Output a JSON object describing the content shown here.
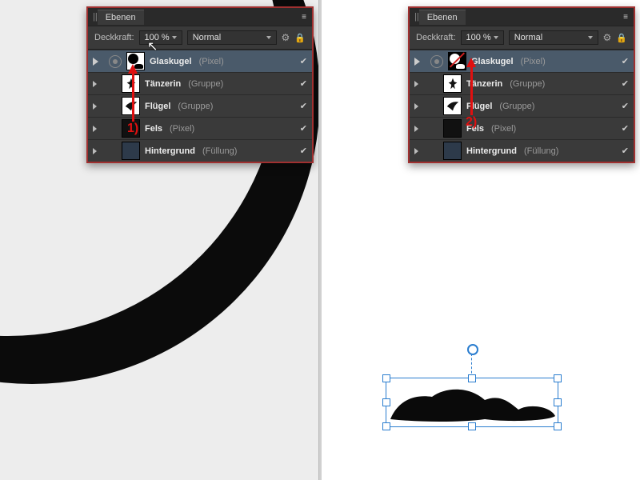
{
  "panel": {
    "title_tab": "Ebenen",
    "opacity_label": "Deckkraft:",
    "opacity_value": "100 %",
    "blend_mode": "Normal"
  },
  "layers": [
    {
      "name": "Glaskugel",
      "type": "(Pixel)",
      "selected": true,
      "thumb": "mask",
      "showPlay": true,
      "showVis": true
    },
    {
      "name": "Tänzerin",
      "type": "(Gruppe)",
      "selected": false,
      "thumb": "dancer",
      "showPlay": false,
      "showVis": false
    },
    {
      "name": "Flügel",
      "type": "(Gruppe)",
      "selected": false,
      "thumb": "wing",
      "showPlay": false,
      "showVis": false
    },
    {
      "name": "Fels",
      "type": "(Pixel)",
      "selected": false,
      "thumb": "empty",
      "showPlay": false,
      "showVis": false
    },
    {
      "name": "Hintergrund",
      "type": "(Füllung)",
      "selected": false,
      "thumb": "bg",
      "showPlay": false,
      "showVis": false
    }
  ],
  "annotations": {
    "left_label": "1)",
    "right_label": "2)"
  }
}
